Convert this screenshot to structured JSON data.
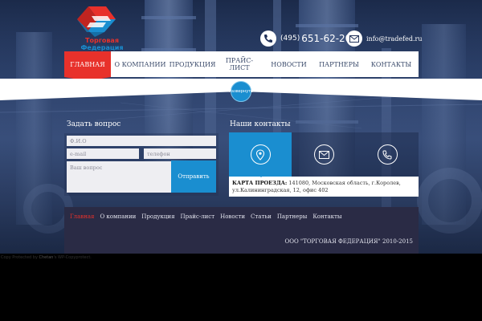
{
  "brand": {
    "name": "Торговая Федерация",
    "accent": "#e8312b",
    "blue": "#1a8ed0"
  },
  "header": {
    "phone_prefix": "(495)",
    "phone_number": "651-62-20",
    "email": "info@tradefed.ru",
    "phone_icon": "handset-icon",
    "mail_icon": "envelope-icon"
  },
  "nav": {
    "items": [
      {
        "label": "ГЛАВНАЯ",
        "active": true
      },
      {
        "label": "О КОМПАНИИ",
        "active": false
      },
      {
        "label": "ПРОДУКЦИЯ",
        "active": false
      },
      {
        "label": "ПРАЙС-ЛИСТ",
        "active": false
      },
      {
        "label": "НОВОСТИ",
        "active": false
      },
      {
        "label": "ПАРТНЕРЫ",
        "active": false
      },
      {
        "label": "КОНТАКТЫ",
        "active": false
      }
    ]
  },
  "expand_button": "Развернуть",
  "question_form": {
    "title": "Задать вопрос",
    "name_placeholder": "Ф.И.О",
    "email_placeholder": "e-mail",
    "phone_placeholder": "телефон",
    "message_placeholder": "Ваш вопрос",
    "submit_label": "Отправить"
  },
  "contacts": {
    "title": "Наши контакты",
    "tiles": [
      {
        "icon": "map-pin-icon",
        "color": "#1a8ed0"
      },
      {
        "icon": "envelope-icon",
        "color": "#0000"
      },
      {
        "icon": "phone-icon",
        "color": "#0000"
      }
    ],
    "map_label": "КАРТА ПРОЕЗДА:",
    "address_line1": " 141080, Московская область, г.Королев,",
    "address_line2": "ул.Калининградская, 12, офис 402"
  },
  "footer": {
    "links": [
      {
        "label": "Главная",
        "active": true
      },
      {
        "label": "О компании",
        "active": false
      },
      {
        "label": "Продукция",
        "active": false
      },
      {
        "label": "Прайс-лист",
        "active": false
      },
      {
        "label": "Новости",
        "active": false
      },
      {
        "label": "Статьи",
        "active": false
      },
      {
        "label": "Партнеры",
        "active": false
      },
      {
        "label": "Контакты",
        "active": false
      }
    ],
    "copyright": "ООО \"ТОРГОВАЯ ФЕДЕРАЦИЯ\" 2010-2015"
  },
  "protection": {
    "prefix": "Copy Protected by ",
    "author": "Chetan",
    "suffix": "'s WP-Copyprotect."
  }
}
